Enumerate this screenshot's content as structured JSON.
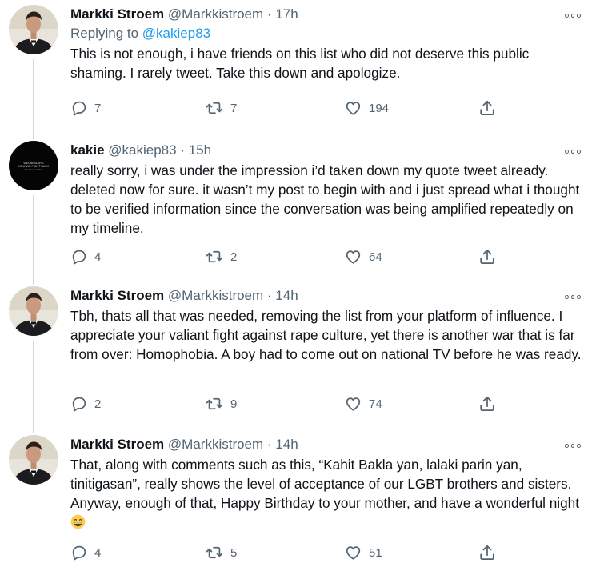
{
  "tweets": [
    {
      "display_name": "Markki Stroem",
      "handle": "@Markkistroem",
      "time": "17h",
      "replying_to_prefix": "Replying to",
      "replying_to_handle": "@kakiep83",
      "text": "This is not enough, i have friends on this list who did not deserve this public shaming. I rarely tweet. Take this down and apologize.",
      "replies": "7",
      "retweets": "7",
      "likes": "194"
    },
    {
      "display_name": "kakie",
      "handle": "@kakiep83",
      "time": "15h",
      "text": "really sorry, i was under the impression i’d taken down my quote tweet already. deleted now for sure. it wasn’t my post to begin with and i just spread what i thought to be verified information since the conversation was being amplified repeatedly on my timeline.",
      "replies": "4",
      "retweets": "2",
      "likes": "64",
      "avatar_text": [
        "WEDNESDAYS",
        "NOW WE FIGHT BACK",
        "#GaAhadndaNay"
      ]
    },
    {
      "display_name": "Markki Stroem",
      "handle": "@Markkistroem",
      "time": "14h",
      "text": "Tbh, thats all that was needed, removing the list from your platform of influence. I appreciate your valiant fight against rape culture, yet there is another war that is far from over: Homophobia. A boy had to come out on national TV before he was ready.",
      "replies": "2",
      "retweets": "9",
      "likes": "74"
    },
    {
      "display_name": "Markki Stroem",
      "handle": "@Markkistroem",
      "time": "14h",
      "text": "That, along with comments such as this, “Kahit Bakla yan, lalaki parin yan, tinitigasan”, really shows the level of acceptance of our LGBT brothers and sisters. Anyway, enough of that, Happy Birthday to your mother, and have a wonderful night",
      "replies": "4",
      "retweets": "5",
      "likes": "51"
    }
  ],
  "separator": "·",
  "icons": [
    "reply-icon",
    "retweet-icon",
    "like-icon",
    "share-icon",
    "more-icon",
    "grinning-emoji"
  ],
  "colors": {
    "link": "#1d9bf0",
    "muted": "#536471",
    "text": "#0f1419",
    "thread_line": "#cfd9de"
  }
}
